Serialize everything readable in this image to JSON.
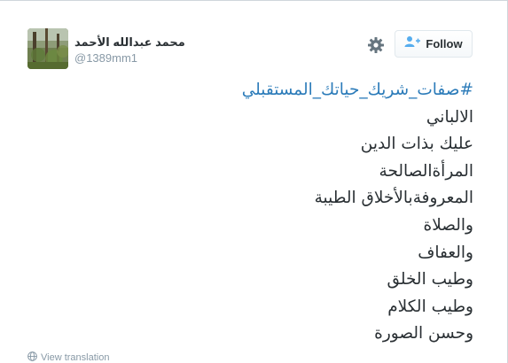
{
  "header": {
    "display_name": "محمد عبدالله الأحمد",
    "username": "@1389mm1"
  },
  "actions": {
    "settings_icon": "gear-icon",
    "follow_icon": "follow-person-plus-icon",
    "follow_label": "Follow"
  },
  "tweet": {
    "hashtag": "#صفات_شريك_حياتك_المستقبلي",
    "lines": [
      "الالباني",
      "عليك بذات الدين",
      "المرأةالصالحة",
      "المعروفةبالأخلاق الطيبة",
      "والصلاة",
      "والعفاف",
      "وطيب الخلق",
      "وطيب الكلام",
      "وحسن الصورة"
    ]
  },
  "footer": {
    "translate_icon": "globe-icon",
    "translate_label": "View translation"
  },
  "colors": {
    "link": "#2b7bb9",
    "text": "#292f33",
    "muted": "#8899a6",
    "follow_icon": "#55acee"
  }
}
